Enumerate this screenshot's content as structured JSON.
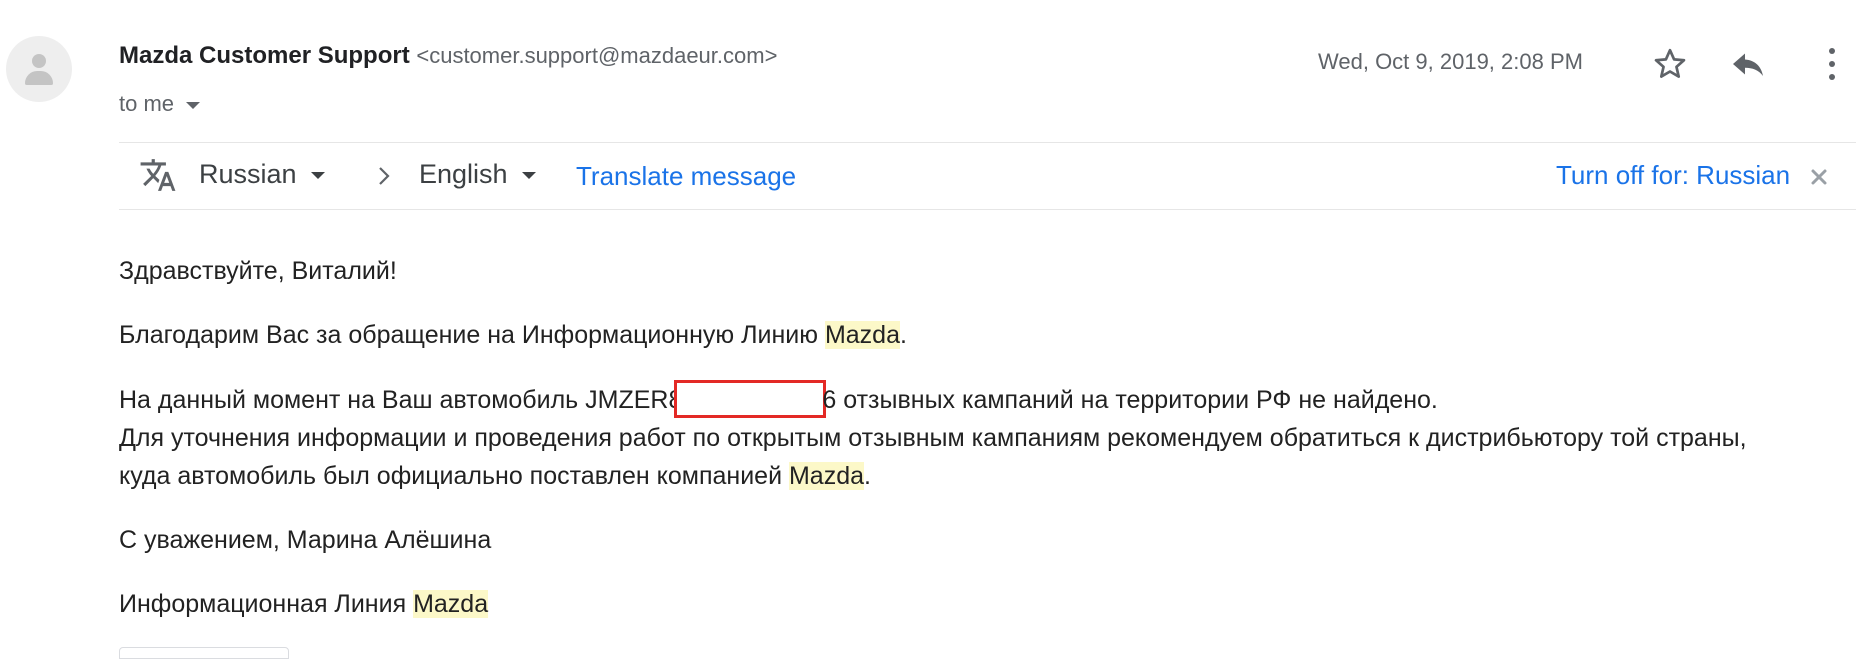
{
  "email": {
    "sender_name": "Mazda Customer Support",
    "sender_email": "<customer.support@mazdaeur.com>",
    "recipient": "to me",
    "date": "Wed, Oct 9, 2019, 2:08 PM"
  },
  "icons": {
    "avatar": "default-person-avatar",
    "star": "star-outline-icon",
    "reply": "reply-icon",
    "more": "more-vertical-icon",
    "translate": "translate-icon",
    "arrow": "chevron-right-icon",
    "close": "close-icon"
  },
  "translate_bar": {
    "source_lang": "Russian",
    "target_lang": "English",
    "translate_link": "Translate message",
    "turn_off": "Turn off for: Russian"
  },
  "body": {
    "greeting": "Здравствуйте, Виталий!",
    "thanks_prefix": "Благодарим Вас за обращение на Информационную Линию ",
    "brand": "Mazda",
    "period": ".",
    "vin_prefix": "На данный момент на Ваш автомобиль JMZER8",
    "vin_suffix": "6 отзывных кампаний на территории РФ не найдено.",
    "line2": "Для уточнения информации и проведения работ по открытым отзывным кампаниям рекомендуем обратиться к дистрибьютору той страны,",
    "line3_prefix": "куда автомобиль был официально поставлен компанией ",
    "signoff": "С уважением, Марина Алёшина",
    "signature_prefix": "Информационная Линия "
  },
  "colors": {
    "link": "#1a73e8",
    "highlight": "#fcf8c8",
    "redaction_border": "#e32925",
    "secondary_text": "#5f6368"
  }
}
